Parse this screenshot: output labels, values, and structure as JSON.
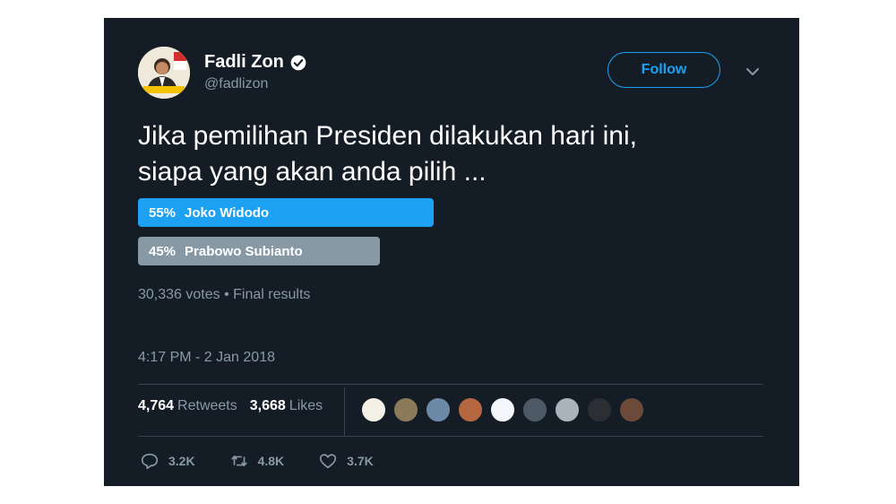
{
  "user": {
    "name": "Fadli Zon",
    "handle": "@fadlizon",
    "verified": true
  },
  "follow_label": "Follow",
  "tweet": {
    "text_line1": "Jika pemilihan Presiden dilakukan hari ini,",
    "text_line2": "siapa yang akan anda pilih ..."
  },
  "poll": {
    "options": [
      {
        "percent_label": "55%",
        "label": "Joko Widodo",
        "fraction": 0.55,
        "color": "#1da1f2"
      },
      {
        "percent_label": "45%",
        "label": "Prabowo Subianto",
        "fraction": 0.45,
        "color": "#8899a6"
      }
    ],
    "votes": "30,336 votes",
    "separator": "•",
    "status": "Final results"
  },
  "timestamp": "4:17 PM - 2 Jan 2018",
  "stats": {
    "retweets_count": "4,764",
    "retweets_label": "Retweets",
    "likes_count": "3,668",
    "likes_label": "Likes"
  },
  "liker_avatars": [
    {
      "icon": "avatar-icon",
      "color": "#f3f0e6"
    },
    {
      "icon": "avatar-icon",
      "color": "#8a7a5a"
    },
    {
      "icon": "avatar-icon",
      "color": "#6d89a8"
    },
    {
      "icon": "avatar-icon",
      "color": "#b5673f"
    },
    {
      "icon": "avatar-icon",
      "color": "#f4f7fb"
    },
    {
      "icon": "avatar-icon",
      "color": "#4d5a66"
    },
    {
      "icon": "avatar-icon",
      "color": "#aab2bb"
    },
    {
      "icon": "avatar-icon",
      "color": "#2b2f33"
    },
    {
      "icon": "avatar-icon",
      "color": "#6b4a3a"
    }
  ],
  "actions": {
    "reply_count": "3.2K",
    "retweet_count": "4.8K",
    "like_count": "3.7K"
  },
  "colors": {
    "background": "#141d26",
    "accent": "#1da1f2",
    "muted": "#8899a6"
  }
}
